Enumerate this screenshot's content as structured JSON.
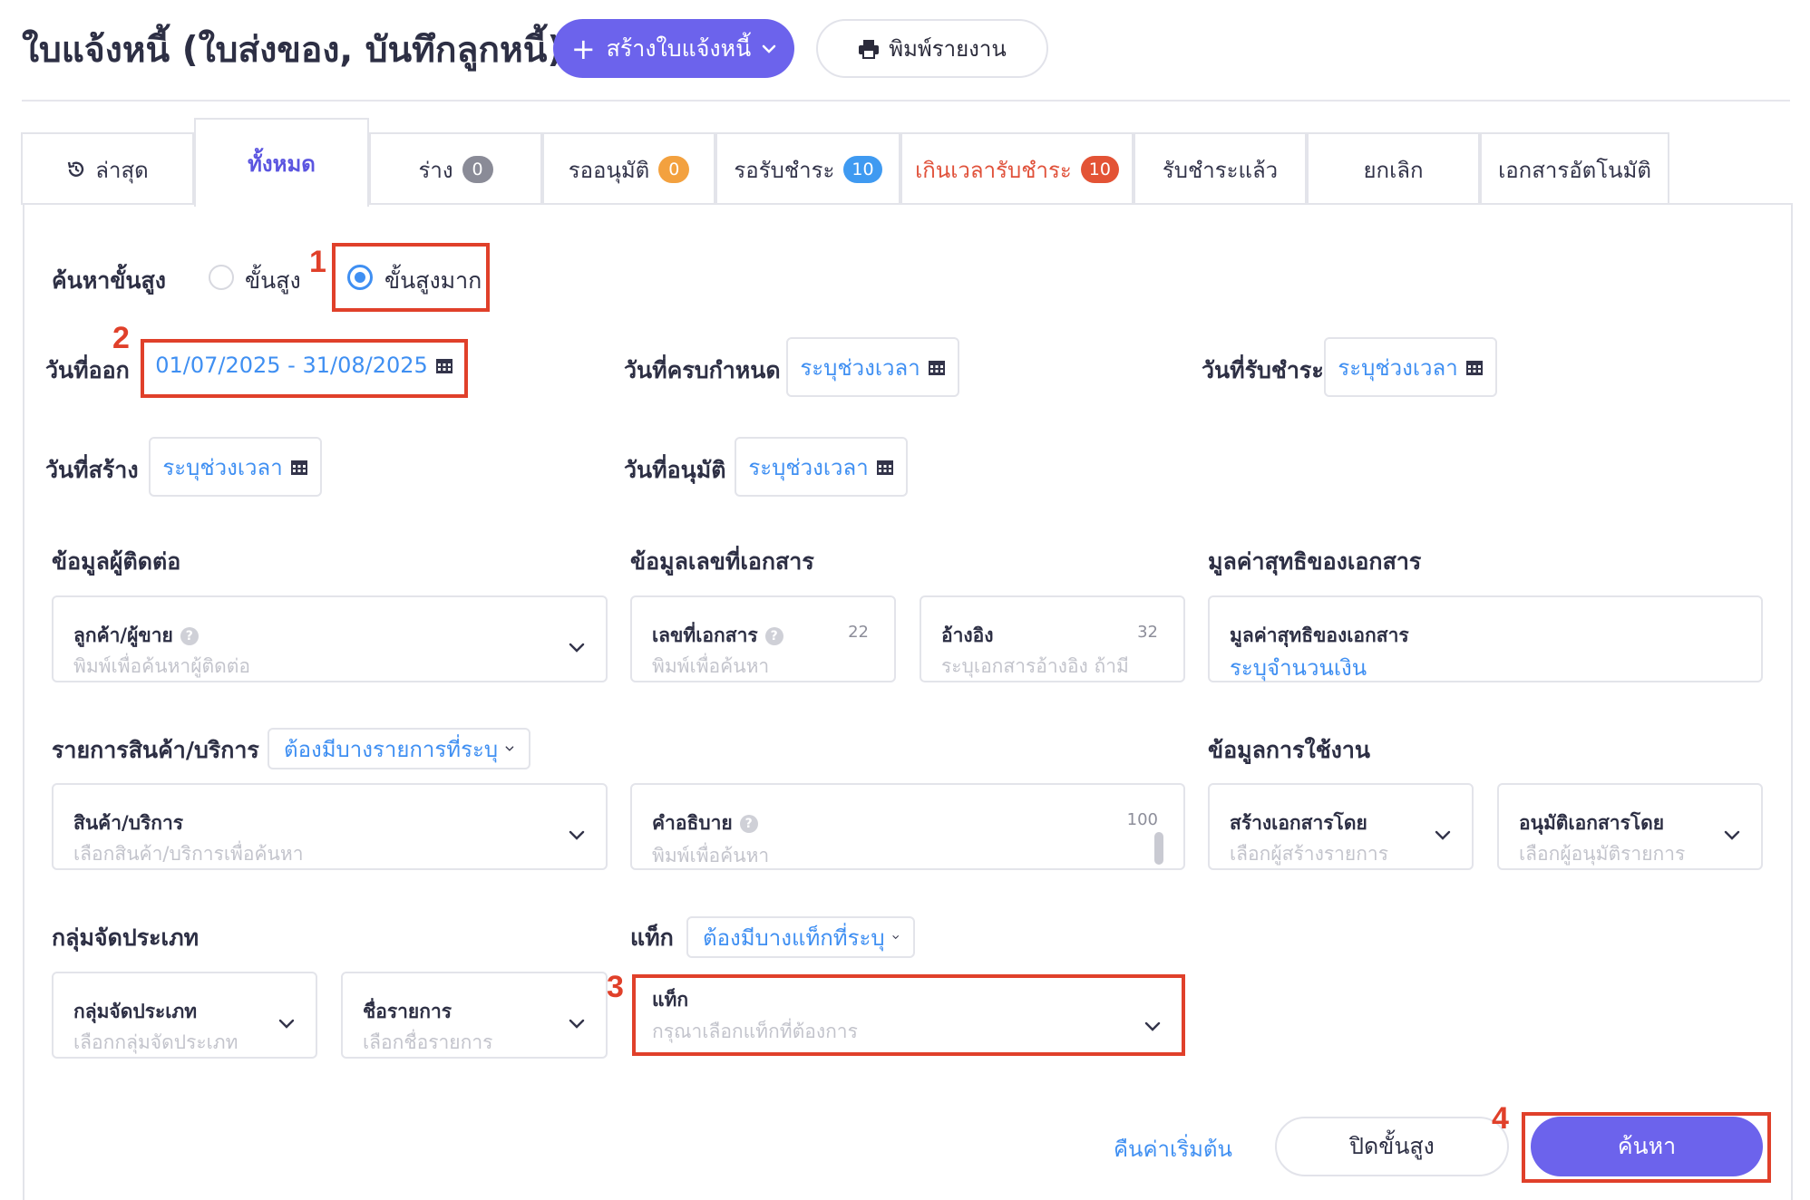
{
  "header": {
    "title": "ใบแจ้งหนี้ (ใบส่งของ, บันทึกลูกหนี้)",
    "create_label": "สร้างใบแจ้งหนี้",
    "print_label": "พิมพ์รายงาน"
  },
  "tabs": [
    {
      "label": "ล่าสุด",
      "icon": "history-icon"
    },
    {
      "label": "ทั้งหมด",
      "active": true
    },
    {
      "label": "ร่าง",
      "count": "0"
    },
    {
      "label": "รออนุมัติ",
      "count": "0"
    },
    {
      "label": "รอรับชำระ",
      "count": "10"
    },
    {
      "label": "เกินเวลารับชำระ",
      "count": "10"
    },
    {
      "label": "รับชำระแล้ว"
    },
    {
      "label": "ยกเลิก"
    },
    {
      "label": "เอกสารอัตโนมัติ"
    }
  ],
  "search": {
    "mode_label": "ค้นหาขั้นสูง",
    "options": [
      "ขั้นสูง",
      "ขั้นสูงมาก"
    ],
    "selected": "ขั้นสูงมาก"
  },
  "dates": {
    "issue_label": "วันที่ออก",
    "issue_value": "01/07/2025 - 31/08/2025",
    "due_label": "วันที่ครบกำหนด",
    "paid_label": "วันที่รับชำระ",
    "created_label": "วันที่สร้าง",
    "approved_label": "วันที่อนุมัติ",
    "placeholder": "ระบุช่วงเวลา"
  },
  "contact_section": {
    "title": "ข้อมูลผู้ติดต่อ",
    "field_title": "ลูกค้า/ผู้ขาย",
    "field_placeholder": "พิมพ์เพื่อค้นหาผู้ติดต่อ"
  },
  "docnum_section": {
    "title": "ข้อมูลเลขที่เอกสาร",
    "doc_title": "เลขที่เอกสาร",
    "doc_placeholder": "พิมพ์เพื่อค้นหา",
    "doc_count": "22",
    "ref_title": "อ้างอิง",
    "ref_placeholder": "ระบุเอกสารอ้างอิง ถ้ามี",
    "ref_count": "32"
  },
  "net_section": {
    "title": "มูลค่าสุทธิของเอกสาร",
    "field_title": "มูลค่าสุทธิของเอกสาร",
    "field_value": "ระบุจำนวนเงิน"
  },
  "products_section": {
    "title": "รายการสินค้า/บริการ",
    "filter": "ต้องมีบางรายการที่ระบุ",
    "field_title": "สินค้า/บริการ",
    "field_placeholder": "เลือกสินค้า/บริการเพื่อค้นหา",
    "desc_title": "คำอธิบาย",
    "desc_placeholder": "พิมพ์เพื่อค้นหา",
    "desc_count": "100"
  },
  "usage_section": {
    "title": "ข้อมูลการใช้งาน",
    "created_by_title": "สร้างเอกสารโดย",
    "created_by_placeholder": "เลือกผู้สร้างรายการ",
    "approved_by_title": "อนุมัติเอกสารโดย",
    "approved_by_placeholder": "เลือกผู้อนุมัติรายการ"
  },
  "category_section": {
    "title": "กลุ่มจัดประเภท",
    "group_title": "กลุ่มจัดประเภท",
    "group_placeholder": "เลือกกลุ่มจัดประเภท",
    "name_title": "ชื่อรายการ",
    "name_placeholder": "เลือกชื่อรายการ"
  },
  "tag_section": {
    "title": "แท็ก",
    "filter": "ต้องมีบางแท็กที่ระบุ",
    "field_title": "แท็ก",
    "field_placeholder": "กรุณาเลือกแท็กที่ต้องการ"
  },
  "actions": {
    "reset": "คืนค่าเริ่มต้น",
    "close": "ปิดขั้นสูง",
    "search": "ค้นหา"
  },
  "annotations": [
    "1",
    "2",
    "3",
    "4"
  ],
  "colors": {
    "accent": "#6c63ec",
    "link": "#3f8ff2",
    "highlight": "#e0402a",
    "overdue": "#e0513a"
  }
}
